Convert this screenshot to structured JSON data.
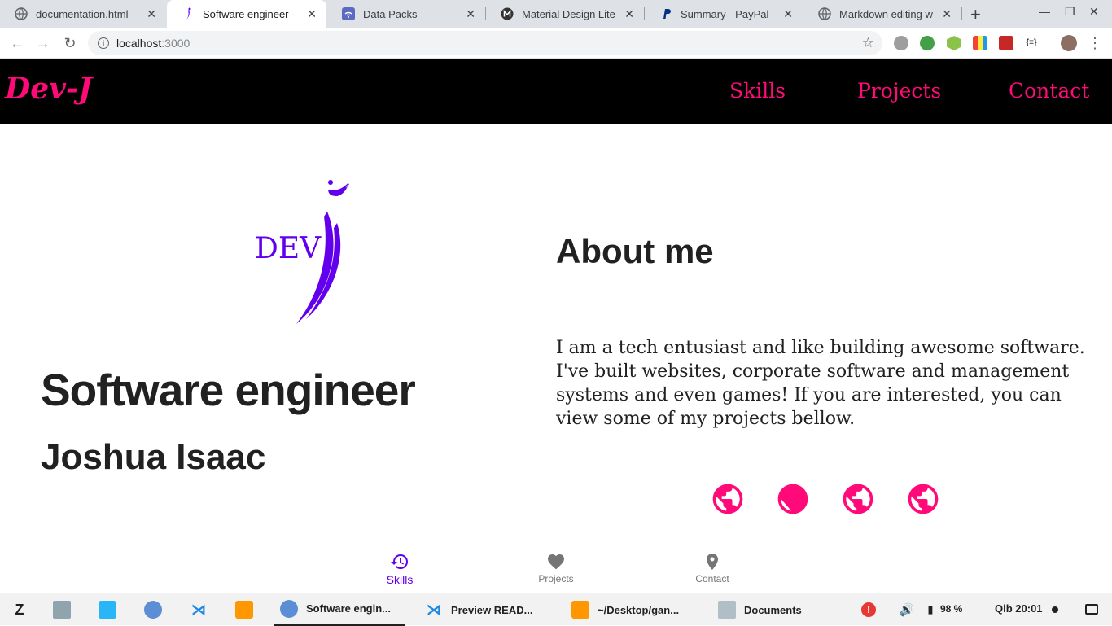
{
  "browser": {
    "tabs": [
      {
        "title": "documentation.html",
        "active": false
      },
      {
        "title": "Software engineer -",
        "active": true
      },
      {
        "title": "Data Packs",
        "active": false
      },
      {
        "title": "Material Design Lite",
        "active": false
      },
      {
        "title": "Summary - PayPal",
        "active": false
      },
      {
        "title": "Markdown editing w",
        "active": false
      }
    ],
    "new_tab": "+",
    "url_host": "localhost",
    "url_port": ":3000"
  },
  "site": {
    "brand": "Dev-J",
    "nav": [
      "Skills",
      "Projects",
      "Contact"
    ],
    "logo_text": "DEV",
    "role": "Software engineer",
    "name": "Joshua Isaac",
    "about_title": "About me",
    "about_text": "I am a tech entusiast and like building awesome software. I've built websites, corporate software and management systems and even games! If you are interested, you can view some of my projects bellow.",
    "bottom_nav": [
      {
        "label": "Skills",
        "icon": "history-icon",
        "active": true
      },
      {
        "label": "Projects",
        "icon": "heart-icon",
        "active": false
      },
      {
        "label": "Contact",
        "icon": "location-pin-icon",
        "active": false
      }
    ],
    "accent": "#ff0a78",
    "purple": "#6200ee"
  },
  "taskbar": {
    "apps": [
      {
        "label": "Software engin...",
        "icon": "chromium-icon"
      },
      {
        "label": "Preview READ...",
        "icon": "vscode-icon"
      },
      {
        "label": "~/Desktop/gan...",
        "icon": "sublime-icon"
      },
      {
        "label": "Documents",
        "icon": "folder-icon"
      }
    ],
    "battery": "98 %",
    "clock": "Qib 20:01"
  }
}
